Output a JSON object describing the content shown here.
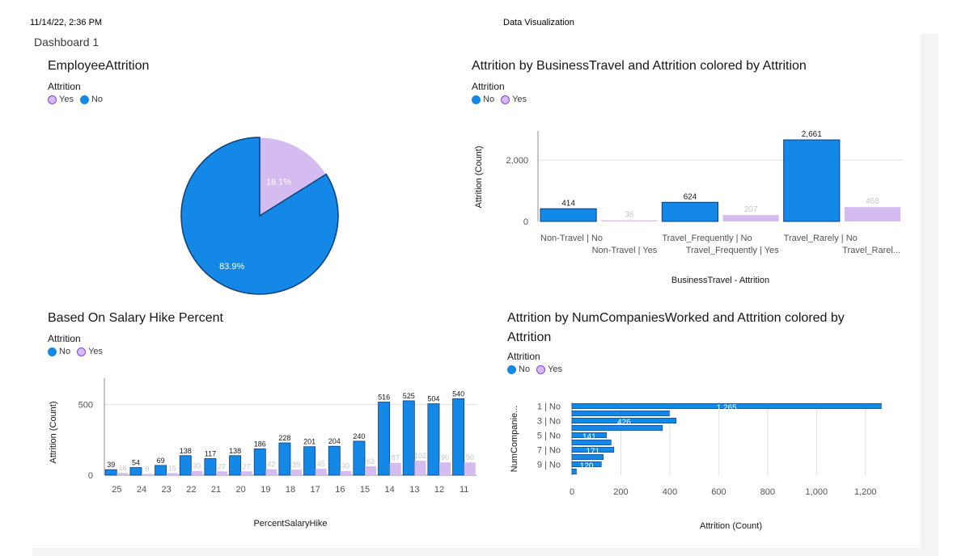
{
  "print_header": {
    "datetime": "11/14/22, 2:36 PM",
    "title": "Data Visualization"
  },
  "dashboard": {
    "title": "Dashboard 1"
  },
  "colors": {
    "no": "#1488e6",
    "yes": "#d4bbf0",
    "no_stroke": "#0d3e7a",
    "yes_stroke": "#8a3ffc",
    "grid": "#e0e0e0"
  },
  "legend_title": "Attrition",
  "legend_no": "No",
  "legend_yes": "Yes",
  "chart_data": [
    {
      "id": "pie",
      "type": "pie",
      "title": "EmployeeAttrition",
      "slices": [
        {
          "label": "Yes",
          "value": 16.1,
          "text": "16.1%"
        },
        {
          "label": "No",
          "value": 83.9,
          "text": "83.9%"
        }
      ]
    },
    {
      "id": "travel",
      "type": "bar",
      "title": "Attrition by BusinessTravel and Attrition colored by Attrition",
      "xlabel": "BusinessTravel - Attrition",
      "ylabel": "Attrition (Count)",
      "ylim": [
        0,
        2900
      ],
      "yticks": [
        0,
        2000
      ],
      "yticklabels": [
        "0",
        "2,000"
      ],
      "categories": [
        "Non-Travel | No",
        "Non-Travel | Yes",
        "Travel_Frequently | No",
        "Travel_Frequently | Yes",
        "Travel_Rarely | No",
        "Travel_Rarel..."
      ],
      "values": [
        414,
        36,
        624,
        207,
        2661,
        468
      ],
      "value_labels": [
        "414",
        "36",
        "624",
        "207",
        "2,661",
        "468"
      ],
      "attrition": [
        "No",
        "Yes",
        "No",
        "Yes",
        "No",
        "Yes"
      ]
    },
    {
      "id": "hike",
      "type": "bar",
      "title": "Based On Salary Hike Percent",
      "xlabel": "PercentSalaryHike",
      "ylabel": "Attrition (Count)",
      "ylim": [
        0,
        650
      ],
      "yticks": [
        0,
        500
      ],
      "yticklabels": [
        "0",
        "500"
      ],
      "categories": [
        "25",
        "24",
        "23",
        "22",
        "21",
        "20",
        "19",
        "18",
        "17",
        "16",
        "15",
        "14",
        "13",
        "12",
        "11"
      ],
      "series": [
        {
          "name": "No",
          "values": [
            39,
            54,
            69,
            138,
            117,
            138,
            186,
            228,
            201,
            204,
            240,
            516,
            525,
            504,
            540
          ]
        },
        {
          "name": "Yes",
          "values": [
            16,
            9,
            15,
            30,
            27,
            27,
            42,
            39,
            45,
            30,
            63,
            87,
            102,
            90,
            90
          ]
        }
      ]
    },
    {
      "id": "companies",
      "type": "bar",
      "orientation": "horizontal",
      "title": "Attrition by NumCompaniesWorked and Attrition colored by Attrition",
      "xlabel": "Attrition (Count)",
      "ylabel": "NumCompanie...",
      "xlim": [
        0,
        1300
      ],
      "xticks": [
        0,
        200,
        400,
        600,
        800,
        1000,
        1200
      ],
      "xticklabels": [
        "0",
        "200",
        "400",
        "600",
        "800",
        "1,000",
        "1,200"
      ],
      "categories": [
        "1 | No",
        "1 | Yes",
        "3 | No",
        "3 | Yes",
        "5 | No",
        "5 | Yes",
        "7 | No",
        "7 | Yes",
        "9 | No",
        "9 | Yes"
      ],
      "shown_categories": [
        "1 | No",
        "3 | No",
        "5 | No",
        "7 | No",
        "9 | No"
      ],
      "values": [
        1265,
        398,
        426,
        370,
        141,
        160,
        171,
        128,
        120,
        18
      ],
      "value_labels": [
        "1,265",
        "",
        "426",
        "",
        "141",
        "",
        "171",
        "",
        "120",
        ""
      ]
    }
  ]
}
